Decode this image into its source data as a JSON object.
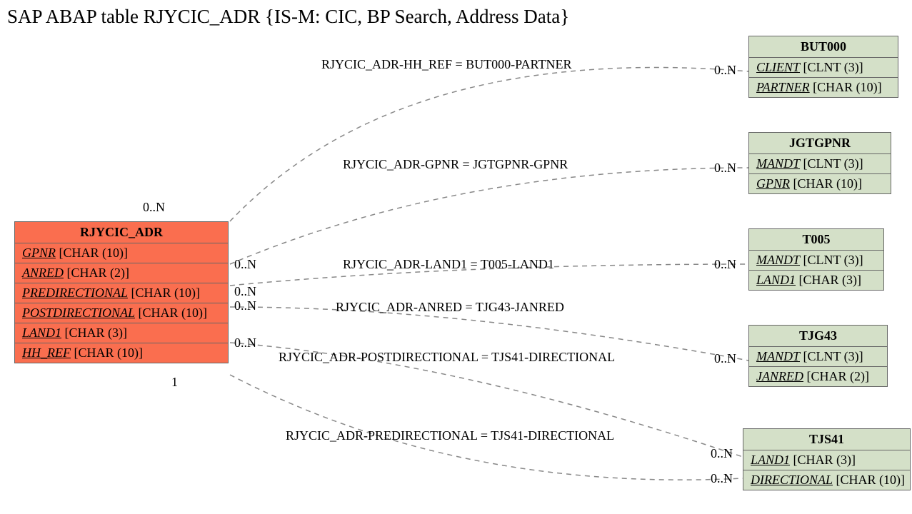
{
  "title": "SAP ABAP table RJYCIC_ADR {IS-M: CIC, BP Search, Address Data}",
  "main_entity": {
    "name": "RJYCIC_ADR",
    "fields": [
      {
        "name": "GPNR",
        "type": "[CHAR (10)]"
      },
      {
        "name": "ANRED",
        "type": "[CHAR (2)]"
      },
      {
        "name": "PREDIRECTIONAL",
        "type": "[CHAR (10)]"
      },
      {
        "name": "POSTDIRECTIONAL",
        "type": "[CHAR (10)]"
      },
      {
        "name": "LAND1",
        "type": "[CHAR (3)]"
      },
      {
        "name": "HH_REF",
        "type": "[CHAR (10)]"
      }
    ]
  },
  "related_entities": [
    {
      "name": "BUT000",
      "fields": [
        {
          "name": "CLIENT",
          "type": "[CLNT (3)]"
        },
        {
          "name": "PARTNER",
          "type": "[CHAR (10)]"
        }
      ]
    },
    {
      "name": "JGTGPNR",
      "fields": [
        {
          "name": "MANDT",
          "type": "[CLNT (3)]"
        },
        {
          "name": "GPNR",
          "type": "[CHAR (10)]"
        }
      ]
    },
    {
      "name": "T005",
      "fields": [
        {
          "name": "MANDT",
          "type": "[CLNT (3)]"
        },
        {
          "name": "LAND1",
          "type": "[CHAR (3)]"
        }
      ]
    },
    {
      "name": "TJG43",
      "fields": [
        {
          "name": "MANDT",
          "type": "[CLNT (3)]"
        },
        {
          "name": "JANRED",
          "type": "[CHAR (2)]"
        }
      ]
    },
    {
      "name": "TJS41",
      "fields": [
        {
          "name": "LAND1",
          "type": "[CHAR (3)]"
        },
        {
          "name": "DIRECTIONAL",
          "type": "[CHAR (10)]"
        }
      ]
    }
  ],
  "relations": [
    {
      "label": "RJYCIC_ADR-HH_REF = BUT000-PARTNER",
      "left_card": "0..N",
      "right_card": "0..N"
    },
    {
      "label": "RJYCIC_ADR-GPNR = JGTGPNR-GPNR",
      "left_card": "0..N",
      "right_card": "0..N"
    },
    {
      "label": "RJYCIC_ADR-LAND1 = T005-LAND1",
      "left_card": "0..N",
      "right_card": "0..N"
    },
    {
      "label": "RJYCIC_ADR-ANRED = TJG43-JANRED",
      "left_card": "0..N",
      "right_card": ""
    },
    {
      "label": "RJYCIC_ADR-POSTDIRECTIONAL = TJS41-DIRECTIONAL",
      "left_card": "0..N",
      "right_card": "0..N"
    },
    {
      "label": "RJYCIC_ADR-PREDIRECTIONAL = TJS41-DIRECTIONAL",
      "left_card": "1",
      "right_card": "0..N"
    }
  ]
}
